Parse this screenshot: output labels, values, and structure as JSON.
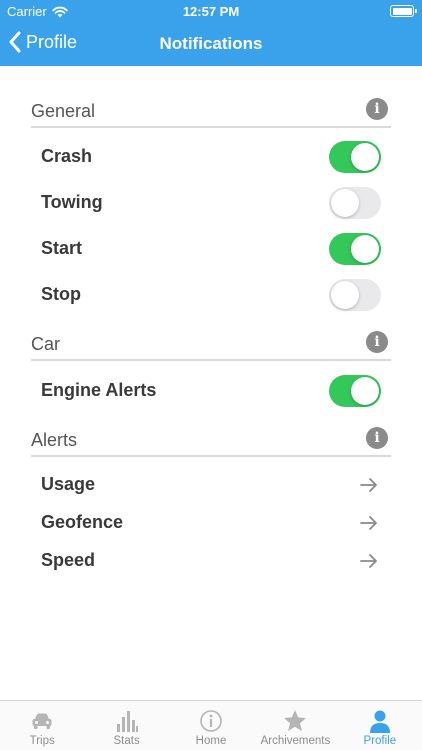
{
  "status": {
    "carrier": "Carrier",
    "time": "12:57 PM"
  },
  "nav": {
    "back_label": "Profile",
    "title": "Notifications"
  },
  "sections": [
    {
      "title": "General",
      "items": [
        {
          "label": "Crash",
          "on": true
        },
        {
          "label": "Towing",
          "on": false
        },
        {
          "label": "Start",
          "on": true
        },
        {
          "label": "Stop",
          "on": false
        }
      ]
    },
    {
      "title": "Car",
      "items": [
        {
          "label": "Engine Alerts",
          "on": true
        }
      ]
    },
    {
      "title": "Alerts",
      "items": [
        {
          "label": "Usage"
        },
        {
          "label": "Geofence"
        },
        {
          "label": "Speed"
        }
      ]
    }
  ],
  "tabs": [
    {
      "label": "Trips",
      "icon": "car-icon"
    },
    {
      "label": "Stats",
      "icon": "bar-chart-icon"
    },
    {
      "label": "Home",
      "icon": "info-circle-icon"
    },
    {
      "label": "Archivements",
      "icon": "star-icon"
    },
    {
      "label": "Profile",
      "icon": "person-icon",
      "active": true
    }
  ],
  "colors": {
    "accent": "#3aa2eb",
    "toggle_on": "#34c759",
    "toggle_off": "#e9e9eb",
    "icon_gray": "#8a8a8a"
  }
}
